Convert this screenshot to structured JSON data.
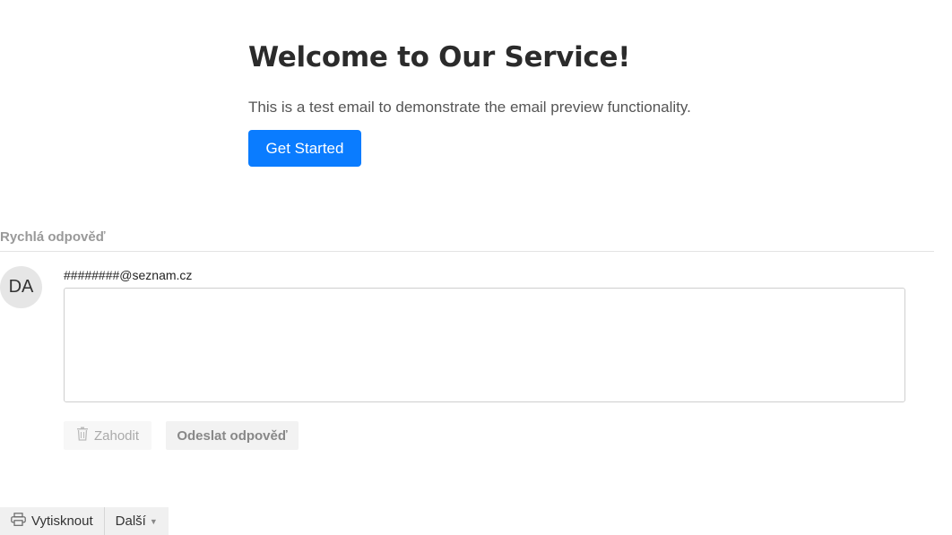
{
  "email": {
    "title": "Welcome to Our Service!",
    "text": "This is a test email to demonstrate the email preview functionality.",
    "cta_label": "Get Started",
    "cta_color": "#0a7cff"
  },
  "quick_reply": {
    "heading": "Rychlá odpověď",
    "avatar_initials": "DA",
    "recipient": "########@seznam.cz",
    "reply_value": "",
    "discard_label": "Zahodit",
    "discard_icon": "trash-icon",
    "send_label": "Odeslat odpověď"
  },
  "toolbar": {
    "print_label": "Vytisknout",
    "print_icon": "printer-icon",
    "more_label": "Další",
    "more_icon": "caret-down-icon"
  }
}
